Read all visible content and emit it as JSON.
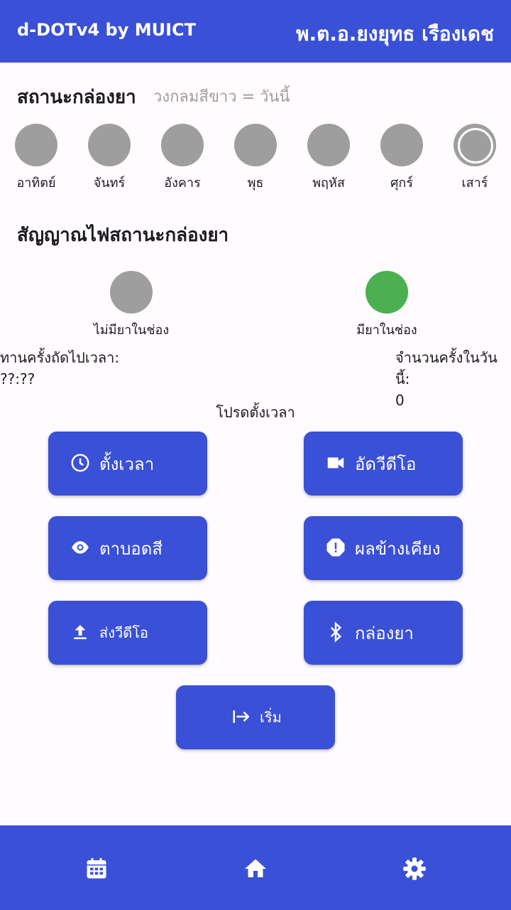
{
  "app": {
    "title": "d-DOTv4 by MUICT",
    "user_name": "พ.ต.อ.ยงยุทธ เรืองเดช"
  },
  "box_status": {
    "title": "สถานะกล่องยา",
    "hint": "วงกลมสีขาว = วันนี้",
    "days": [
      "อาทิตย์",
      "จันทร์",
      "อังคาร",
      "พุธ",
      "พฤหัส",
      "ศุกร์",
      "เสาร์"
    ],
    "today_index": 6
  },
  "signal": {
    "title": "สัญญาณไฟสถานะกล่องยา",
    "empty_label": "ไม่มียาในช่อง",
    "has_label": "มียาในช่อง"
  },
  "next_dose": {
    "label": "ทานครั้งถัดไปเวลา:",
    "value": "??:??"
  },
  "today_count": {
    "label": "จำนวนครั้งในวันนี้:",
    "value": "0"
  },
  "prompt": "โปรดตั้งเวลา",
  "buttons": {
    "set_time": "ตั้งเวลา",
    "record_video": "อัดวีดีโอ",
    "color_blind": "ตาบอดสี",
    "side_effects": "ผลข้างเคียง",
    "send_video": "ส่งวีดีโอ",
    "pill_box": "กล่องยา",
    "start": "เริ่ม"
  },
  "colors": {
    "primary": "#3a50d6",
    "inactive": "#9e9e9e",
    "active": "#4caf50"
  },
  "nav": [
    "calendar-icon",
    "home-icon",
    "settings-icon"
  ]
}
